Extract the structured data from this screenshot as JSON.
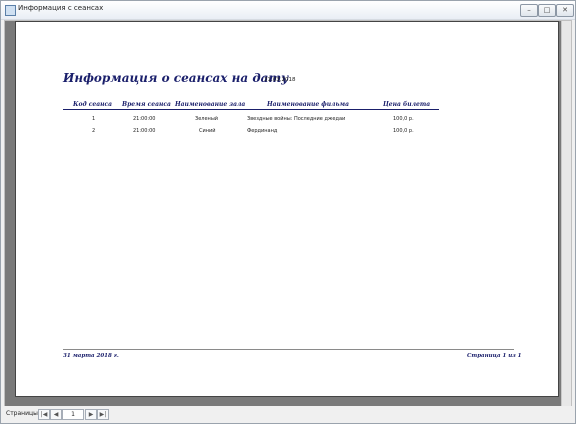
{
  "window": {
    "title": "Информация с сеансах",
    "min_glyph": "–",
    "max_glyph": "□",
    "close_glyph": "✕"
  },
  "report": {
    "title": "Информация о сеансах на дату",
    "date": "31.03.2018",
    "columns": [
      "Код сеанса",
      "Время сеанса",
      "Наименование зала",
      "Наименование фильма",
      "Цена билета"
    ],
    "rows": [
      [
        "1",
        "21:00:00",
        "Зеленый",
        "Звездные войны: Последние джедаи",
        "100,0 р."
      ],
      [
        "2",
        "21:00:00",
        "Синий",
        "Фердинанд",
        "100,0 р."
      ]
    ],
    "footer_left": "31 марта 2018 г.",
    "footer_right": "Страница 1 из 1"
  },
  "navigator": {
    "label": "Страницы:",
    "first": "|◀",
    "prev": "◀",
    "current_page": "1",
    "next": "▶",
    "last": "▶|"
  }
}
